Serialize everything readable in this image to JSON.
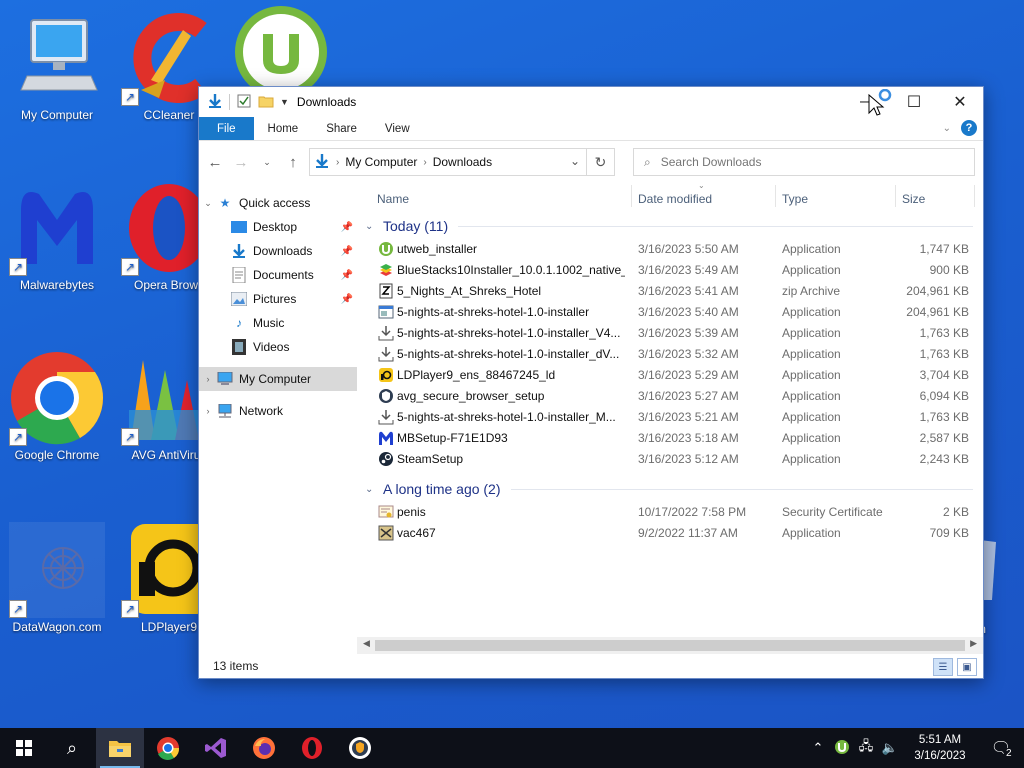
{
  "desktop": {
    "icons": [
      {
        "label": "My Computer"
      },
      {
        "label": "CCleaner"
      },
      {
        "label": "Malwarebytes"
      },
      {
        "label": "Opera Brows"
      },
      {
        "label": "Google Chrome"
      },
      {
        "label": "AVG AntiVirus"
      },
      {
        "label": "DataWagon.com"
      },
      {
        "label": "LDPlayer9"
      },
      {
        "label": "m"
      }
    ]
  },
  "window": {
    "title": "Downloads",
    "ribbon_tabs": [
      "File",
      "Home",
      "Share",
      "View"
    ],
    "address": {
      "parts": [
        "My Computer",
        "Downloads"
      ]
    },
    "search_placeholder": "Search Downloads",
    "nav": {
      "quick_access": "Quick access",
      "items": [
        "Desktop",
        "Downloads",
        "Documents",
        "Pictures",
        "Music",
        "Videos"
      ],
      "my_computer": "My Computer",
      "network": "Network"
    },
    "columns": [
      "Name",
      "Date modified",
      "Type",
      "Size"
    ],
    "groups": [
      {
        "header": "Today (11)",
        "files": [
          {
            "name": "utweb_installer",
            "date": "3/16/2023 5:50 AM",
            "type": "Application",
            "size": "1,747 KB",
            "icon": "utorrent-web-icon"
          },
          {
            "name": "BlueStacks10Installer_10.0.1.1002_native_...",
            "date": "3/16/2023 5:49 AM",
            "type": "Application",
            "size": "900 KB",
            "icon": "bluestacks-icon"
          },
          {
            "name": "5_Nights_At_Shreks_Hotel",
            "date": "3/16/2023 5:41 AM",
            "type": "zip Archive",
            "size": "204,961 KB",
            "icon": "zip-icon"
          },
          {
            "name": "5-nights-at-shreks-hotel-1.0-installer",
            "date": "3/16/2023 5:40 AM",
            "type": "Application",
            "size": "204,961 KB",
            "icon": "installer-window-icon"
          },
          {
            "name": "5-nights-at-shreks-hotel-1.0-installer_V4...",
            "date": "3/16/2023 5:39 AM",
            "type": "Application",
            "size": "1,763 KB",
            "icon": "download-installer-icon"
          },
          {
            "name": "5-nights-at-shreks-hotel-1.0-installer_dV...",
            "date": "3/16/2023 5:32 AM",
            "type": "Application",
            "size": "1,763 KB",
            "icon": "download-installer-icon"
          },
          {
            "name": "LDPlayer9_ens_88467245_ld",
            "date": "3/16/2023 5:29 AM",
            "type": "Application",
            "size": "3,704 KB",
            "icon": "ldplayer-icon"
          },
          {
            "name": "avg_secure_browser_setup",
            "date": "3/16/2023 5:27 AM",
            "type": "Application",
            "size": "6,094 KB",
            "icon": "avg-browser-icon"
          },
          {
            "name": "5-nights-at-shreks-hotel-1.0-installer_M...",
            "date": "3/16/2023 5:21 AM",
            "type": "Application",
            "size": "1,763 KB",
            "icon": "download-installer-icon"
          },
          {
            "name": "MBSetup-F71E1D93",
            "date": "3/16/2023 5:18 AM",
            "type": "Application",
            "size": "2,587 KB",
            "icon": "malwarebytes-icon"
          },
          {
            "name": "SteamSetup",
            "date": "3/16/2023 5:12 AM",
            "type": "Application",
            "size": "2,243 KB",
            "icon": "steam-icon"
          }
        ]
      },
      {
        "header": "A long time ago (2)",
        "files": [
          {
            "name": "penis",
            "date": "10/17/2022 7:58 PM",
            "type": "Security Certificate",
            "size": "2 KB",
            "icon": "certificate-icon"
          },
          {
            "name": "vac467",
            "date": "9/2/2022 11:37 AM",
            "type": "Application",
            "size": "709 KB",
            "icon": "app-icon"
          }
        ]
      }
    ],
    "status": "13 items"
  },
  "taskbar": {
    "clock_time": "5:51 AM",
    "clock_date": "3/16/2023",
    "notification_count": "2"
  }
}
